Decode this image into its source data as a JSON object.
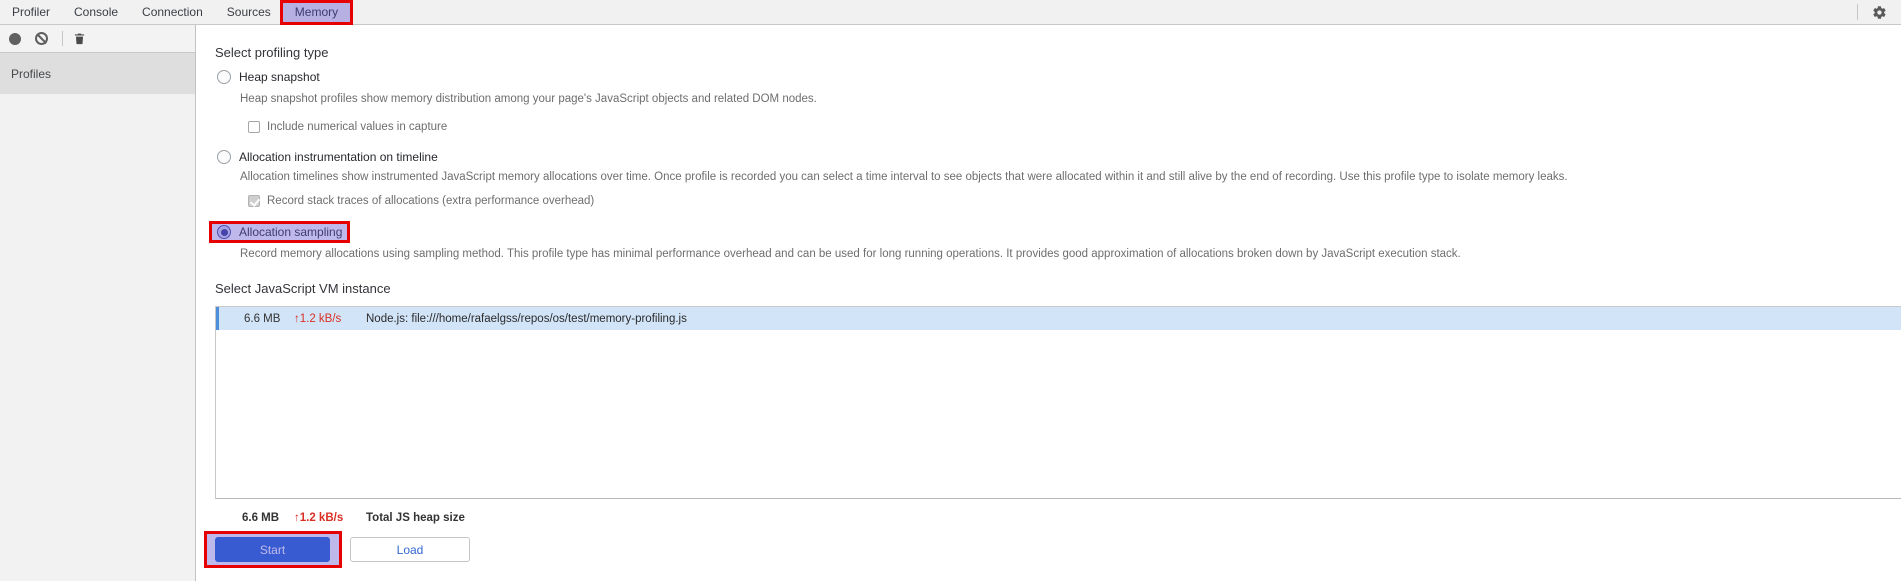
{
  "tabbar": {
    "tabs": [
      {
        "label": "Profiler",
        "active": false
      },
      {
        "label": "Console",
        "active": false
      },
      {
        "label": "Connection",
        "active": false
      },
      {
        "label": "Sources",
        "active": false
      },
      {
        "label": "Memory",
        "active": true,
        "annotated": true
      }
    ]
  },
  "toolbar": {
    "icons": [
      "record-icon",
      "clear-icon",
      "trash-icon"
    ]
  },
  "settings": {
    "icon": "gear-icon"
  },
  "sidebar": {
    "profiles_header": "Profiles"
  },
  "profiling": {
    "heading": "Select profiling type",
    "options": [
      {
        "label": "Heap snapshot",
        "selected": false,
        "description": "Heap snapshot profiles show memory distribution among your page's JavaScript objects and related DOM nodes.",
        "checkbox": {
          "label": "Include numerical values in capture",
          "checked": false,
          "disabled": false
        }
      },
      {
        "label": "Allocation instrumentation on timeline",
        "selected": false,
        "description": "Allocation timelines show instrumented JavaScript memory allocations over time. Once profile is recorded you can select a time interval to see objects that were allocated within it and still alive by the end of recording. Use this profile type to isolate memory leaks.",
        "checkbox": {
          "label": "Record stack traces of allocations (extra performance overhead)",
          "checked": true,
          "disabled": true
        }
      },
      {
        "label": "Allocation sampling",
        "selected": true,
        "annotated": true,
        "description": "Record memory allocations using sampling method. This profile type has minimal performance overhead and can be used for long running operations. It provides good approximation of allocations broken down by JavaScript execution stack."
      }
    ]
  },
  "vm_section": {
    "heading": "Select JavaScript VM instance",
    "instances": [
      {
        "heap_size": "6.6 MB",
        "allocation_rate": "↑1.2 kB/s",
        "name": "Node.js: file:///home/rafaelgss/repos/os/test/memory-profiling.js",
        "selected": true
      }
    ],
    "summary": {
      "heap_size": "6.6 MB",
      "allocation_rate": "↑1.2 kB/s",
      "label": "Total JS heap size"
    }
  },
  "actions": {
    "start_label": "Start",
    "load_label": "Load"
  },
  "colors": {
    "annotation_border": "#e60000",
    "annotation_fill": "rgba(100,88,205,0.42)",
    "selected_row_bg": "#d2e4f8",
    "selected_row_stripe": "#4d8fdb",
    "rate_red": "#d93025",
    "primary_button_bg": "#1a5ed6",
    "primary_button_text": "#ffffff",
    "tabbar_bg": "#f1f1f1"
  }
}
